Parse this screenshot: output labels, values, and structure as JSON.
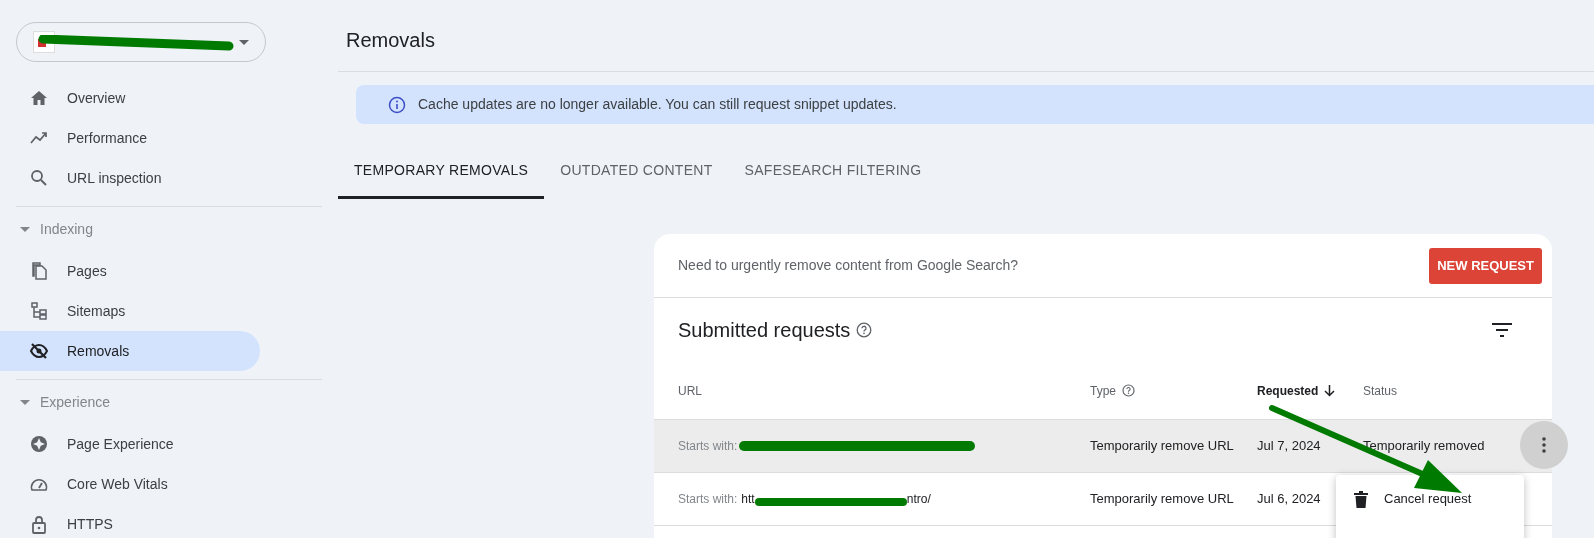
{
  "property_selector": {
    "redacted": true
  },
  "sidebar": {
    "items": [
      {
        "kind": "item",
        "label": "Overview",
        "selected": false
      },
      {
        "kind": "item",
        "label": "Performance",
        "selected": false
      },
      {
        "kind": "item",
        "label": "URL inspection",
        "selected": false
      },
      {
        "kind": "section",
        "label": "Indexing",
        "expanded": true
      },
      {
        "kind": "item",
        "label": "Pages",
        "selected": false
      },
      {
        "kind": "item",
        "label": "Sitemaps",
        "selected": false
      },
      {
        "kind": "item",
        "label": "Removals",
        "selected": true
      },
      {
        "kind": "section",
        "label": "Experience",
        "expanded": true
      },
      {
        "kind": "item",
        "label": "Page Experience",
        "selected": false
      },
      {
        "kind": "item",
        "label": "Core Web Vitals",
        "selected": false
      },
      {
        "kind": "item",
        "label": "HTTPS",
        "selected": false
      }
    ]
  },
  "page_title": "Removals",
  "banner": "Cache updates are no longer available. You can still request snippet updates.",
  "tabs": [
    {
      "label": "TEMPORARY REMOVALS",
      "selected": true
    },
    {
      "label": "OUTDATED CONTENT",
      "selected": false
    },
    {
      "label": "SAFESEARCH FILTERING",
      "selected": false
    }
  ],
  "card": {
    "prompt": "Need to urgently remove content from Google Search?",
    "button": "NEW REQUEST",
    "title": "Submitted requests",
    "columns": [
      {
        "label": "URL",
        "help": false,
        "sorted": false
      },
      {
        "label": "Type",
        "help": true,
        "sorted": false
      },
      {
        "label": "Requested",
        "help": false,
        "sorted": true
      },
      {
        "label": "Status",
        "help": false,
        "sorted": false
      }
    ],
    "rows": [
      {
        "prefix": "Starts with:",
        "redacted": true,
        "type": "Temporarily remove URL",
        "requested": "Jul 7, 2024",
        "status": "Temporarily removed",
        "selected": true
      },
      {
        "prefix": "Starts with:",
        "url_start": "htt",
        "redacted": true,
        "url_end": "ntro/",
        "type": "Temporarily remove URL",
        "requested": "Jul 6, 2024",
        "selected": false
      }
    ],
    "menu": [
      {
        "label": "Cancel request"
      }
    ]
  },
  "annotation": {
    "arrow": true
  }
}
